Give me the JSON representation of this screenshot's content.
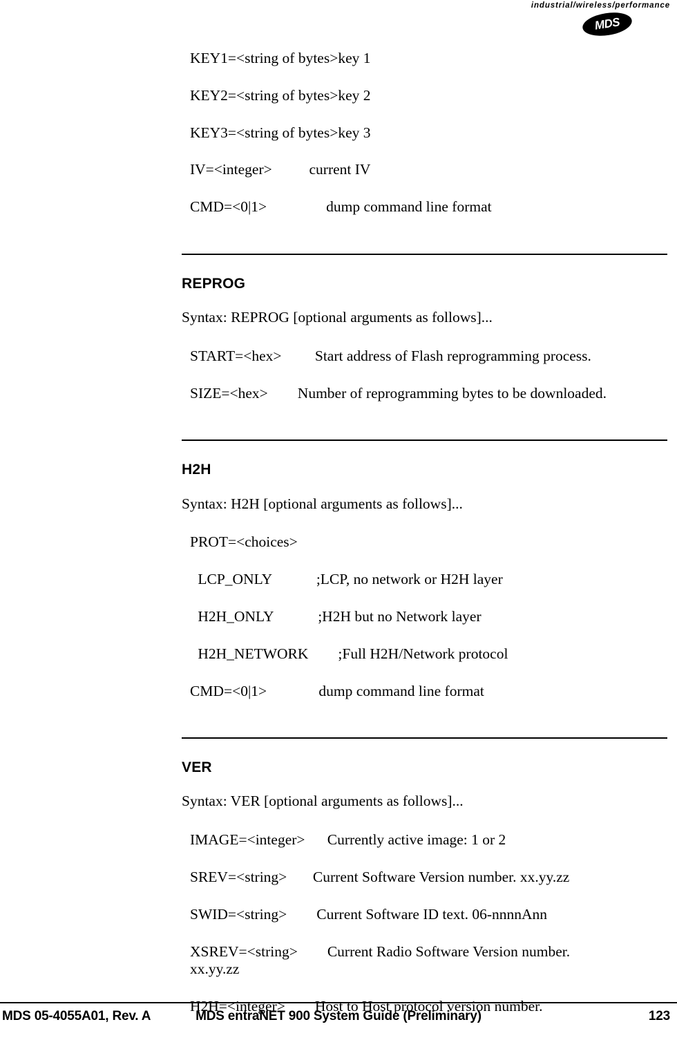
{
  "header": {
    "tagline": "industrial/wireless/performance",
    "logo_text": "MDS"
  },
  "top_block": {
    "lines": [
      "KEY1=<string of bytes>key 1",
      "KEY2=<string of bytes>key 2",
      "KEY3=<string of bytes>key 3",
      "IV=<integer>          current IV",
      "CMD=<0|1>                dump command line format"
    ]
  },
  "sections": [
    {
      "heading": "REPROG",
      "syntax": "Syntax: REPROG [optional arguments as follows]...",
      "args": [
        "START=<hex>         Start address of Flash reprogramming process.",
        "SIZE=<hex>        Number of reprogramming bytes to be downloaded."
      ]
    },
    {
      "heading": "H2H",
      "syntax": "Syntax: H2H [optional arguments as follows]...",
      "args": [
        "PROT=<choices>",
        " LCP_ONLY            ;LCP, no network or H2H layer",
        " H2H_ONLY            ;H2H but no Network layer",
        " H2H_NETWORK        ;Full H2H/Network protocol",
        "CMD=<0|1>              dump command line format"
      ]
    },
    {
      "heading": "VER",
      "syntax": "Syntax: VER [optional arguments as follows]...",
      "args": [
        "IMAGE=<integer>      Currently active image: 1 or 2",
        "SREV=<string>       Current Software Version number. xx.yy.zz",
        "SWID=<string>        Current Software ID text. 06-nnnnAnn",
        "XSREV=<string>        Current Radio Software Version number.\nxx.yy.zz",
        "H2H=<integer>        Host to Host protocol version number."
      ]
    }
  ],
  "footer": {
    "left": "MDS 05-4055A01, Rev. A",
    "center": "MDS entraNET 900 System Guide (Preliminary)",
    "right": "123"
  }
}
